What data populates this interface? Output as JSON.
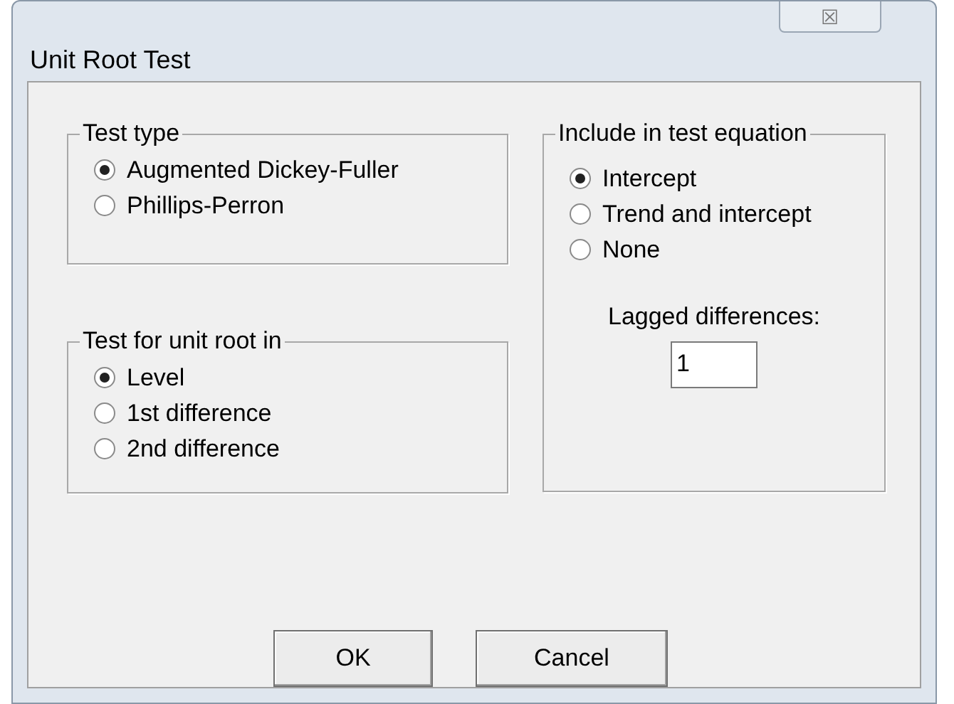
{
  "window": {
    "title": "Unit Root Test",
    "close": "☒"
  },
  "test_type": {
    "title": "Test type",
    "options": [
      {
        "label": "Augmented Dickey-Fuller",
        "selected": true
      },
      {
        "label": "Phillips-Perron",
        "selected": false
      }
    ]
  },
  "unit_root_in": {
    "title": "Test for unit root in",
    "options": [
      {
        "label": "Level",
        "selected": true
      },
      {
        "label": "1st difference",
        "selected": false
      },
      {
        "label": "2nd difference",
        "selected": false
      }
    ]
  },
  "include": {
    "title": "Include in test equation",
    "options": [
      {
        "label": "Intercept",
        "selected": true
      },
      {
        "label": "Trend and intercept",
        "selected": false
      },
      {
        "label": "None",
        "selected": false
      }
    ],
    "lag_label": "Lagged differences:",
    "lag_value": "1"
  },
  "buttons": [
    "OK",
    "Cancel"
  ]
}
